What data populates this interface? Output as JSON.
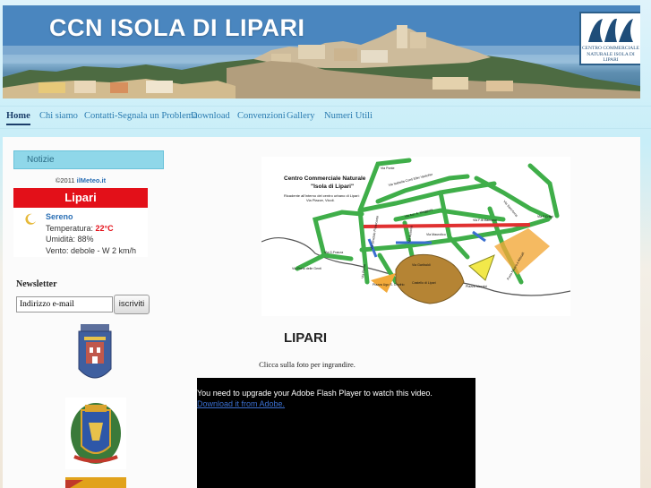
{
  "site": {
    "title": "CCN ISOLA DI LIPARI",
    "logo_text": "CENTRO COMMERCIALE NATURALE ISOLA DI LIPARI"
  },
  "nav": {
    "items": [
      "Home",
      "Chi siamo",
      "Contatti-Segnala un Problema",
      "Download",
      "Convenzioni",
      "Gallery",
      "Numeri Utili"
    ],
    "active": "Home"
  },
  "sidebar": {
    "notizie_label": "Notizie",
    "meteo": {
      "copyright": "©2011",
      "brand": "ilMeteo.it",
      "city": "Lipari",
      "sky": "Sereno",
      "temp_label": "Temperatura:",
      "temp_value": "22°C",
      "humidity": "Umidità: 88%",
      "wind": "Vento: debole - W 2 km/h",
      "icon": "moon-icon"
    },
    "newsletter": {
      "title": "Newsletter",
      "input_value": "Indirizzo e-mail",
      "button": "iscriviti"
    }
  },
  "main": {
    "map": {
      "title": "Centro Commerciale Naturale",
      "subtitle": "\"Isola di Lipari\"",
      "note": "Ricadente all'interno del centro urbano di Lipari:",
      "streets_list": "Via Piazze, Vicoli.",
      "labels": [
        "Via Ponte",
        "Via Isabella Conti Eller Vanicher",
        "Via Stradale Pianoconte",
        "Via Ausonia",
        "Via Aur. A. Meggiore",
        "Via F.lli Mancuso",
        "Via Sant'Anna",
        "Via G.Franza",
        "Via Porto delle Genti",
        "Via Roma",
        "Via Garibaldi",
        "Via Maurolico",
        "Via F.Crispi",
        "Piazza Mazzini",
        "Castello di Lipari",
        "Porto Nuovo e Aliscafi",
        "Piazza Ugo S. Onofrio"
      ],
      "city": "LIPARI",
      "caption": "Clicca sulla foto per ingrandire."
    },
    "flash": {
      "message": "You need to upgrade your Adobe Flash Player to watch this video.",
      "link": "Download it from Adobe."
    }
  },
  "colors": {
    "accent": "#2a7bb0",
    "meteo_red": "#e31019",
    "notizie_bg": "#8fd7e9"
  }
}
